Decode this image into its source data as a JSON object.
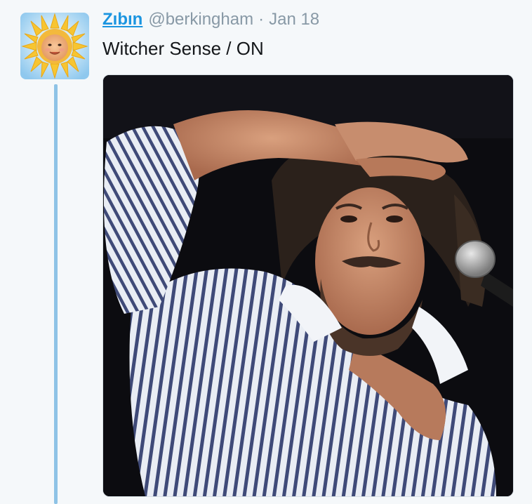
{
  "tweet": {
    "display_name": "Zıbın",
    "handle": "@berkingham",
    "separator": "·",
    "timestamp": "Jan 18",
    "text": "Witcher Sense / ON"
  },
  "avatar": {
    "icon": "sun-baby-avatar-icon",
    "colors": {
      "sky": "#a7d6f2",
      "sun": "#f7c531",
      "face": "#f2b27c"
    }
  },
  "media": {
    "icon": "photo-image",
    "colors": {
      "background": "#0b0b0d",
      "shirt": "#e8ecf3",
      "stripe": "#3f4a78",
      "skin": "#c58c6e",
      "hair": "#2a1f1a"
    }
  },
  "colors": {
    "link": "#1b95e0",
    "muted": "#8899a6",
    "text": "#14171a",
    "thread_line": "#8ec3e6",
    "page_bg": "#f5f8fa"
  }
}
